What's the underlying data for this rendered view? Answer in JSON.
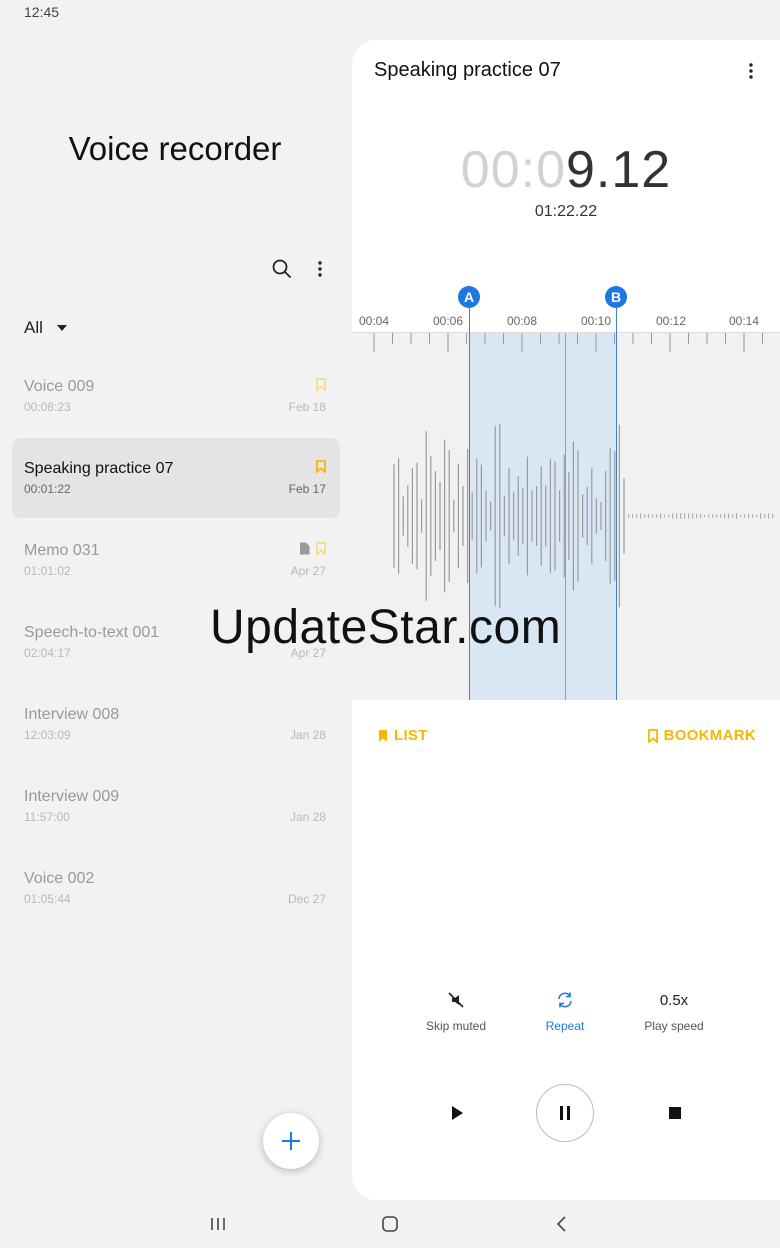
{
  "status_bar": {
    "time": "12:45"
  },
  "left_pane": {
    "app_title": "Voice recorder",
    "filter": {
      "selected": "All"
    },
    "recordings": [
      {
        "name": "Voice 009",
        "duration": "00:08:23",
        "date": "Feb 18",
        "bookmarked": true,
        "has_text": false,
        "active": false
      },
      {
        "name": "Speaking practice 07",
        "duration": "00:01:22",
        "date": "Feb 17",
        "bookmarked": true,
        "has_text": false,
        "active": true
      },
      {
        "name": "Memo 031",
        "duration": "01:01:02",
        "date": "Apr 27",
        "bookmarked": true,
        "has_text": true,
        "active": false
      },
      {
        "name": "Speech-to-text 001",
        "duration": "02:04:17",
        "date": "Apr 27",
        "bookmarked": false,
        "has_text": false,
        "active": false
      },
      {
        "name": "Interview 008",
        "duration": "12:03:09",
        "date": "Jan 28",
        "bookmarked": false,
        "has_text": false,
        "active": false
      },
      {
        "name": "Interview 009",
        "duration": "11:57:00",
        "date": "Jan 28",
        "bookmarked": false,
        "has_text": false,
        "active": false
      },
      {
        "name": "Voice 002",
        "duration": "01:05:44",
        "date": "Dec 27",
        "bookmarked": false,
        "has_text": false,
        "active": false
      }
    ]
  },
  "player": {
    "title": "Speaking practice 07",
    "elapsed_dim": "00:0",
    "elapsed_bright": "9.12",
    "total": "01:22.22",
    "timeline_labels": [
      "00:04",
      "00:06",
      "00:08",
      "00:10",
      "00:12",
      "00:14"
    ],
    "markers": {
      "a": "A",
      "b": "B"
    },
    "list_label": "LIST",
    "bookmark_label": "BOOKMARK",
    "options": {
      "skip_muted": "Skip muted",
      "repeat": "Repeat",
      "speed_value": "0.5x",
      "speed_label": "Play speed"
    }
  },
  "watermark": "UpdateStar.com",
  "colors": {
    "accent_blue": "#1e78e0",
    "bookmark_yellow": "#f5b800",
    "selection": "#d9e6f3",
    "playhead": "#e07c8d"
  }
}
